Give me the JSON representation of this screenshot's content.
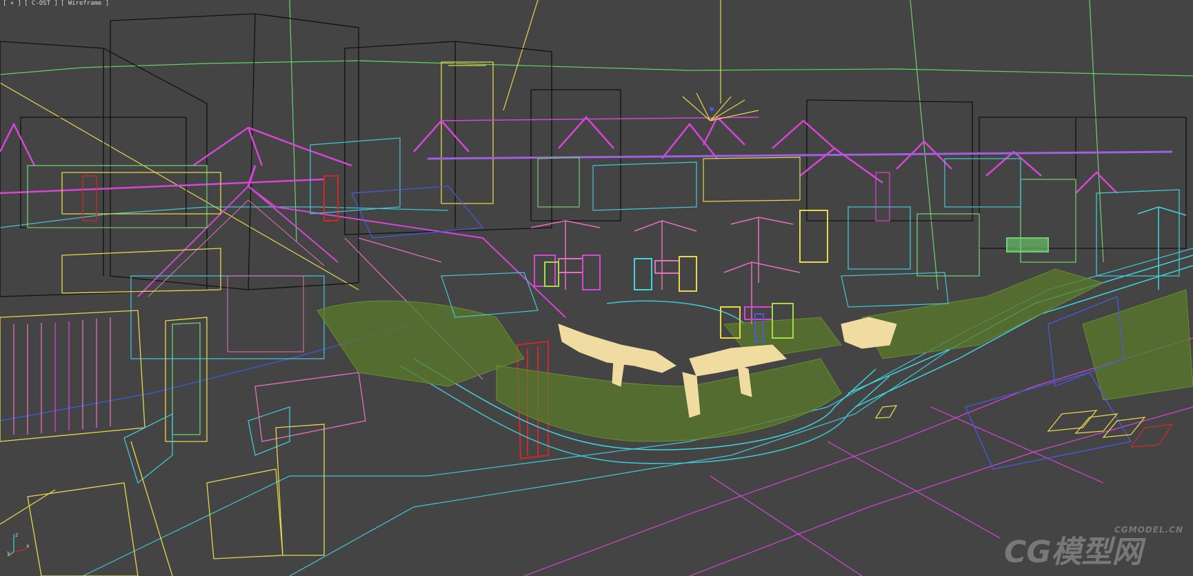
{
  "viewport": {
    "menu_label": "[ + ]",
    "view_label": "[ C-OST ]",
    "shading_label": "[ Wireframe ]"
  },
  "axes": {
    "x": "x",
    "y": "y",
    "z": "z"
  },
  "watermark": {
    "small": "CGMODEL.CN",
    "main": "CG模型网"
  },
  "colors": {
    "background": "#444444",
    "magenta": "#d845d8",
    "cyan": "#3fd6e0",
    "yellow": "#e8d84a",
    "green": "#6fd26f",
    "lime": "#a0e040",
    "black": "#111111",
    "red": "#d02828",
    "blue": "#4a5ae0",
    "pink": "#e870c0",
    "grass": "#5a7a2a",
    "cream": "#f0dca0"
  }
}
